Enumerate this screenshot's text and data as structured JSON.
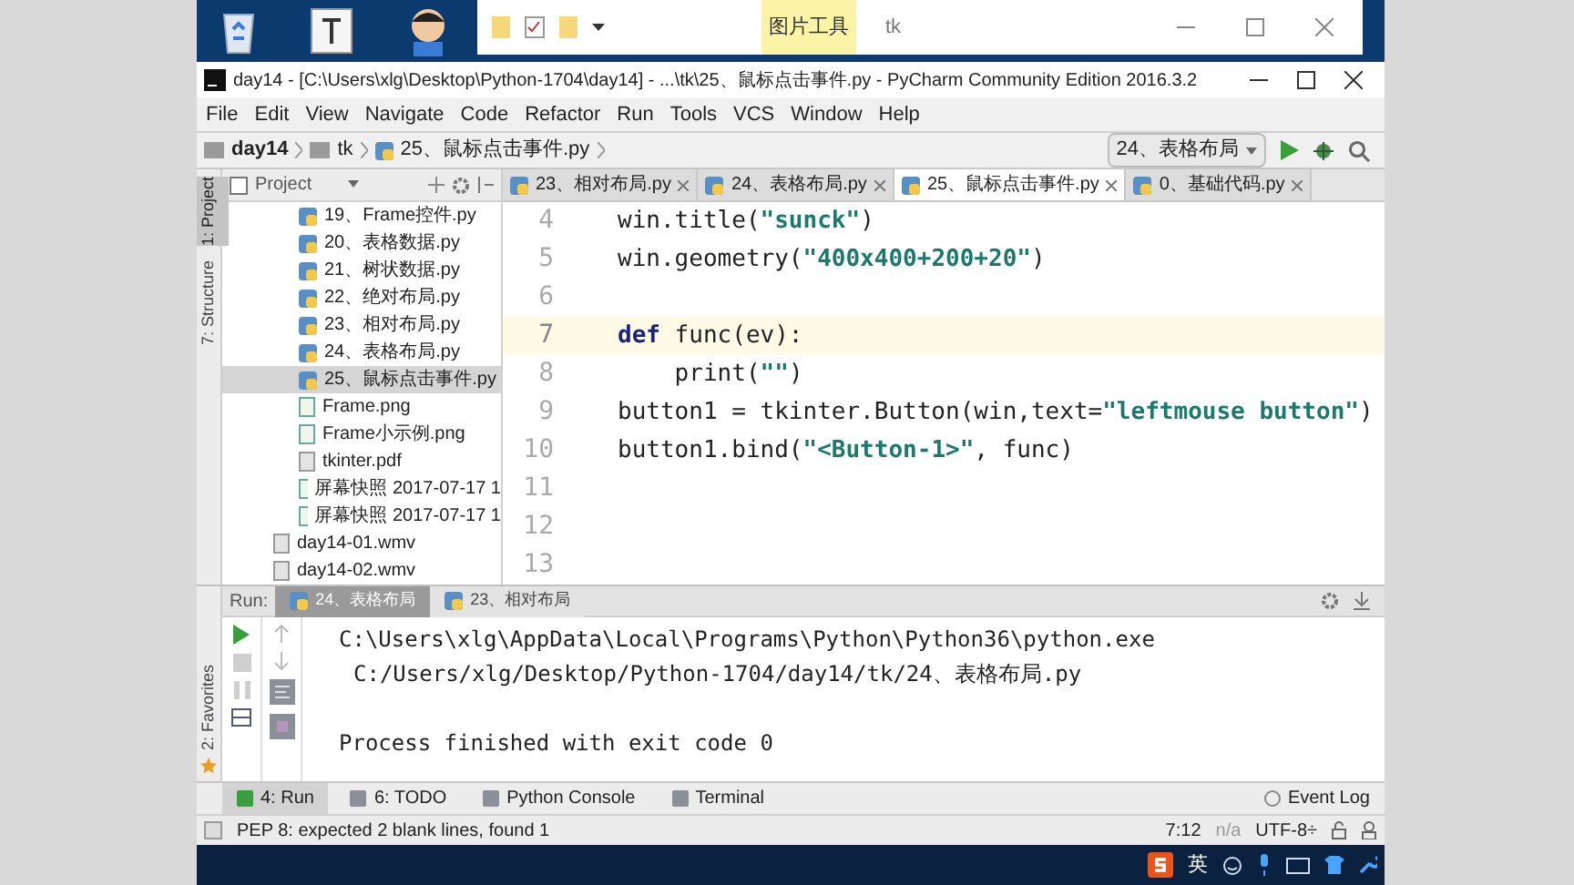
{
  "explorer": {
    "ribbon_tab": "图片工具",
    "title": "tk"
  },
  "window": {
    "title": "day14 - [C:\\Users\\xlg\\Desktop\\Python-1704\\day14] - ...\\tk\\25、鼠标点击事件.py - PyCharm Community Edition 2016.3.2"
  },
  "menu": [
    "File",
    "Edit",
    "View",
    "Navigate",
    "Code",
    "Refactor",
    "Run",
    "Tools",
    "VCS",
    "Window",
    "Help"
  ],
  "breadcrumbs": [
    "day14",
    "tk",
    "25、鼠标点击事件.py"
  ],
  "run_config": "24、表格布局",
  "left_stripe": [
    {
      "label": "1: Project",
      "selected": true
    },
    {
      "label": "7: Structure",
      "selected": false
    }
  ],
  "favorites_label": "2: Favorites",
  "project_panel": {
    "title": "Project",
    "tree": [
      {
        "children": [
          {
            "name": "19、Frame控件.py",
            "kind": "py",
            "selected": false
          },
          {
            "name": "20、表格数据.py",
            "kind": "py",
            "selected": false
          },
          {
            "name": "21、树状数据.py",
            "kind": "py",
            "selected": false
          },
          {
            "name": "22、绝对布局.py",
            "kind": "py",
            "selected": false
          },
          {
            "name": "23、相对布局.py",
            "kind": "py",
            "selected": false
          },
          {
            "name": "24、表格布局.py",
            "kind": "py",
            "selected": false
          },
          {
            "name": "25、鼠标点击事件.py",
            "kind": "py",
            "selected": true
          },
          {
            "name": "Frame.png",
            "kind": "image",
            "selected": false
          },
          {
            "name": "Frame小示例.png",
            "kind": "image",
            "selected": false
          },
          {
            "name": "tkinter.pdf",
            "kind": "file",
            "selected": false
          },
          {
            "name": "屏幕快照 2017-07-17 1",
            "kind": "image",
            "selected": false
          },
          {
            "name": "屏幕快照 2017-07-17 1",
            "kind": "image",
            "selected": false
          }
        ]
      },
      {
        "name": "day14-01.wmv",
        "kind": "file",
        "selected": false
      },
      {
        "name": "day14-02.wmv",
        "kind": "file",
        "selected": false
      }
    ]
  },
  "tabs": [
    {
      "label": "23、相对布局.py",
      "selected": false
    },
    {
      "label": "24、表格布局.py",
      "selected": false
    },
    {
      "label": "25、鼠标点击事件.py",
      "selected": true
    },
    {
      "label": "0、基础代码.py",
      "selected": false
    }
  ],
  "editor": {
    "lines": [
      {
        "number": "4",
        "current": false,
        "tokens": [
          {
            "text": "win.title(",
            "kind": "plain"
          },
          {
            "text": "\"sunck\"",
            "kind": "string"
          },
          {
            "text": ")",
            "kind": "plain"
          }
        ]
      },
      {
        "number": "5",
        "current": false,
        "tokens": [
          {
            "text": "win.geometry(",
            "kind": "plain"
          },
          {
            "text": "\"400x400+200+20\"",
            "kind": "string"
          },
          {
            "text": ")",
            "kind": "plain"
          }
        ]
      },
      {
        "number": "6",
        "current": false
      },
      {
        "number": "7",
        "current": true,
        "tokens": [
          {
            "text": "def",
            "kind": "keyword"
          },
          {
            "text": " func(ev):",
            "kind": "plain"
          }
        ]
      },
      {
        "number": "8",
        "current": false,
        "tokens": [
          {
            "text": "    print(",
            "kind": "plain"
          },
          {
            "text": "\"\"",
            "kind": "string"
          },
          {
            "text": ")",
            "kind": "plain"
          }
        ]
      },
      {
        "number": "9",
        "current": false,
        "tokens": [
          {
            "text": "button1 = tkinter.Button(win,text=",
            "kind": "plain"
          },
          {
            "text": "\"leftmouse button\"",
            "kind": "string"
          },
          {
            "text": ")",
            "kind": "plain"
          }
        ]
      },
      {
        "number": "10",
        "current": false,
        "tokens": [
          {
            "text": "button1.bind(",
            "kind": "plain"
          },
          {
            "text": "\"<Button-1>\"",
            "kind": "string"
          },
          {
            "text": ", func)",
            "kind": "plain"
          }
        ]
      },
      {
        "number": "11",
        "current": false
      },
      {
        "number": "12",
        "current": false
      },
      {
        "number": "13",
        "current": false
      }
    ]
  },
  "run_panel": {
    "label": "Run:",
    "tabs": [
      {
        "label": "24、表格布局",
        "selected": true
      },
      {
        "label": "23、相对布局",
        "selected": false
      }
    ],
    "output": [
      {
        "text": "C:\\Users\\xlg\\AppData\\Local\\Programs\\Python\\Python36\\python.exe",
        "kind": "command"
      },
      {
        "text": "C:/Users/xlg/Desktop/Python-1704/day14/tk/24、表格布局.py",
        "kind": "path"
      },
      {
        "text": "Process finished with exit code 0",
        "kind": "status"
      }
    ]
  },
  "tool_windows": [
    {
      "label": "4: Run",
      "selected": true
    },
    {
      "label": "6: TODO",
      "selected": false
    },
    {
      "label": "Python Console",
      "selected": false
    },
    {
      "label": "Terminal",
      "selected": false
    }
  ],
  "event_log": "Event Log",
  "status_bar": {
    "message": "PEP 8: expected 2 blank lines, found 1",
    "position": "7:12",
    "separator": "n/a",
    "encoding": "UTF-8÷"
  },
  "taskbar": {
    "ime_mode": "英"
  }
}
